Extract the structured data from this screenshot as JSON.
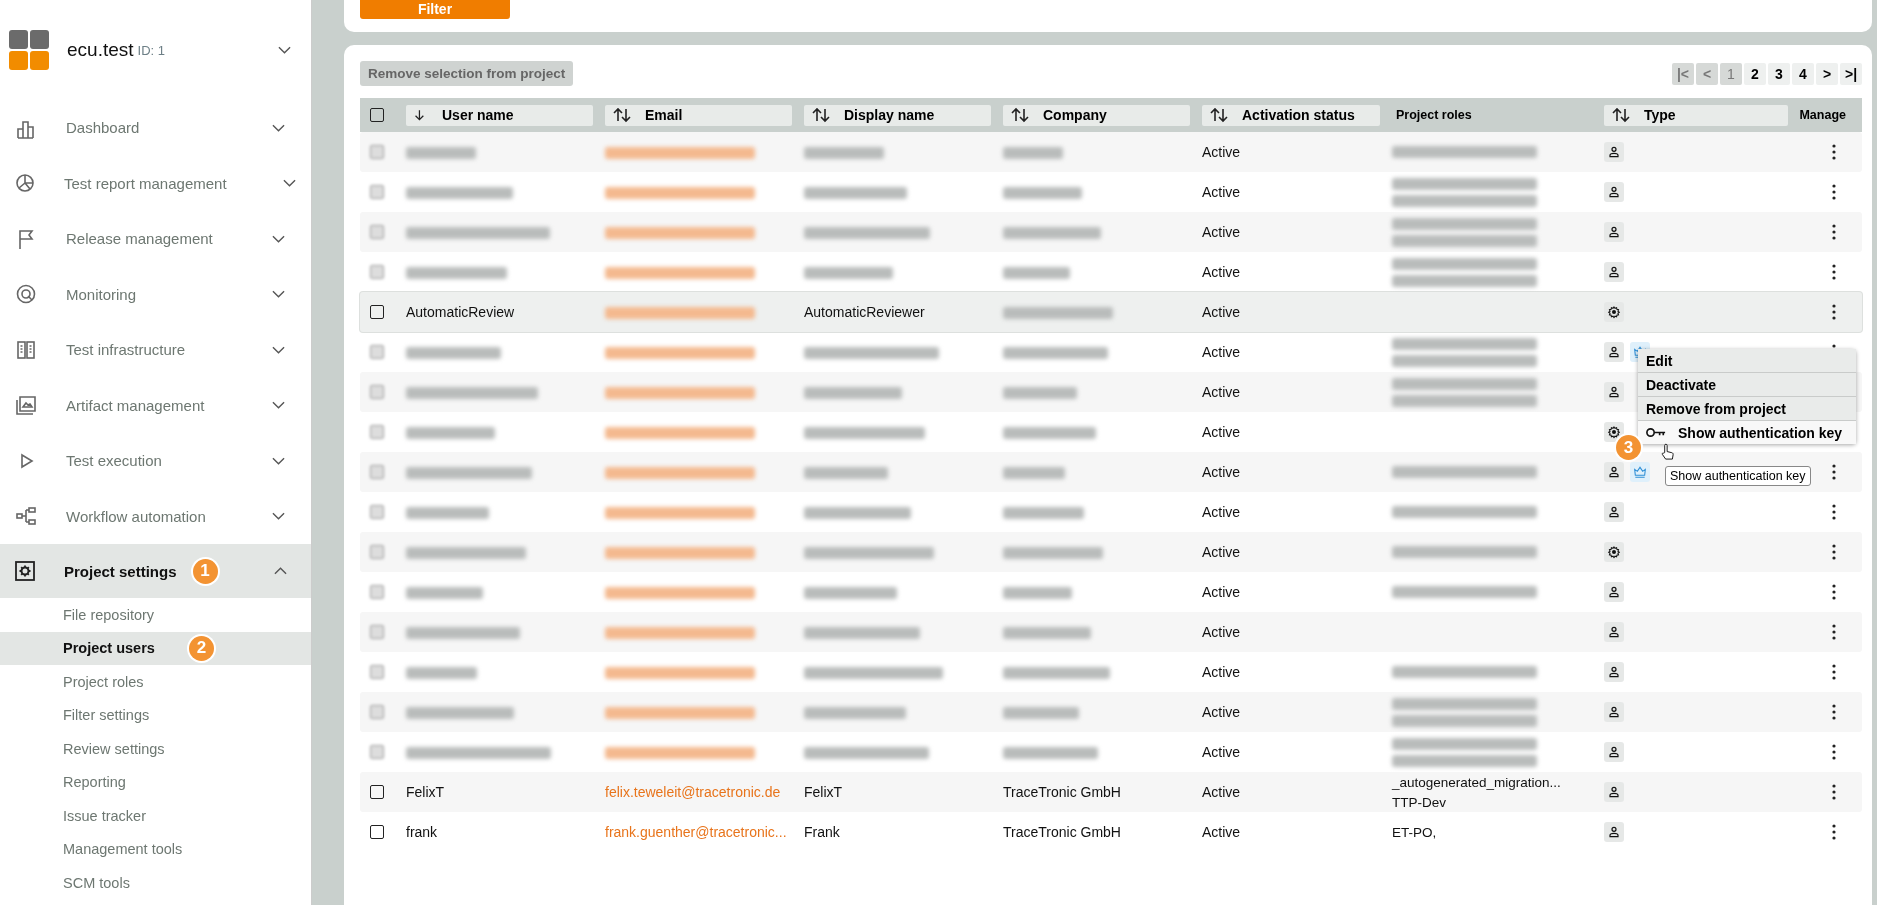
{
  "sidebar": {
    "product": "ecu.test",
    "product_id": "ID: 1",
    "items": [
      {
        "label": "Dashboard",
        "expanded": false,
        "selected": false
      },
      {
        "label": "Test report management",
        "expanded": false,
        "selected": false
      },
      {
        "label": "Release management",
        "expanded": false,
        "selected": false
      },
      {
        "label": "Monitoring",
        "expanded": false,
        "selected": false
      },
      {
        "label": "Test infrastructure",
        "expanded": false,
        "selected": false
      },
      {
        "label": "Artifact management",
        "expanded": false,
        "selected": false
      },
      {
        "label": "Test execution",
        "expanded": false,
        "selected": false
      },
      {
        "label": "Workflow automation",
        "expanded": false,
        "selected": false
      },
      {
        "label": "Project settings",
        "expanded": true,
        "selected": true,
        "marker": "1",
        "children": [
          {
            "label": "File repository",
            "selected": false
          },
          {
            "label": "Project users",
            "selected": true,
            "marker": "2"
          },
          {
            "label": "Project roles",
            "selected": false
          },
          {
            "label": "Filter settings",
            "selected": false
          },
          {
            "label": "Review settings",
            "selected": false
          },
          {
            "label": "Reporting",
            "selected": false
          },
          {
            "label": "Issue tracker",
            "selected": false
          },
          {
            "label": "Management tools",
            "selected": false
          },
          {
            "label": "SCM tools",
            "selected": false
          }
        ]
      }
    ]
  },
  "filter_button": "Filter",
  "remove_button": {
    "label": "Remove selection from project",
    "disabled": true
  },
  "pagination": {
    "first": {
      "label": "|<",
      "disabled": true
    },
    "prev": {
      "label": "<",
      "disabled": true
    },
    "pages": [
      {
        "label": "1",
        "selected": true
      },
      {
        "label": "2",
        "selected": false
      },
      {
        "label": "3",
        "selected": false
      },
      {
        "label": "4",
        "selected": false
      }
    ],
    "next": {
      "label": ">",
      "disabled": false
    },
    "last": {
      "label": ">|",
      "disabled": false
    }
  },
  "table": {
    "select_all_checked": false,
    "columns": [
      {
        "label": "User name",
        "kind": "sorted"
      },
      {
        "label": "Email",
        "kind": "sortable"
      },
      {
        "label": "Display name",
        "kind": "sortable"
      },
      {
        "label": "Company",
        "kind": "sortable"
      },
      {
        "label": "Activation status",
        "kind": "sortable"
      },
      {
        "label": "Project roles",
        "kind": "plain"
      },
      {
        "label": "Type",
        "kind": "sortable"
      },
      {
        "label": "Manage",
        "kind": "plain"
      }
    ],
    "rows": [
      {
        "checked": false,
        "blurred": true,
        "highlighted": false,
        "status": "Active",
        "roles": [
          {
            "blurred": true
          }
        ],
        "kind": "user",
        "admin": false
      },
      {
        "checked": false,
        "blurred": true,
        "highlighted": false,
        "status": "Active",
        "roles": [
          {
            "blurred": true
          },
          {
            "blurred": true
          }
        ],
        "kind": "user",
        "admin": false
      },
      {
        "checked": false,
        "blurred": true,
        "highlighted": false,
        "status": "Active",
        "roles": [
          {
            "blurred": true
          },
          {
            "blurred": true
          }
        ],
        "kind": "user",
        "admin": false
      },
      {
        "checked": false,
        "blurred": true,
        "highlighted": false,
        "status": "Active",
        "roles": [
          {
            "blurred": true
          },
          {
            "blurred": true
          }
        ],
        "kind": "user",
        "admin": false
      },
      {
        "checked": false,
        "blurred": false,
        "highlighted": true,
        "user_name": "AutomaticReview",
        "email": {
          "blurred": true
        },
        "display_name": "AutomaticReviewer",
        "company": {
          "blurred": true
        },
        "status": "Active",
        "roles": [],
        "kind": "technical",
        "admin": false
      },
      {
        "checked": false,
        "blurred": true,
        "highlighted": false,
        "status": "Active",
        "roles": [
          {
            "blurred": true
          },
          {
            "blurred": true
          }
        ],
        "kind": "user",
        "admin": true
      },
      {
        "checked": false,
        "blurred": true,
        "highlighted": false,
        "status": "Active",
        "roles": [
          {
            "blurred": true
          },
          {
            "blurred": true
          }
        ],
        "kind": "user",
        "admin": false
      },
      {
        "checked": false,
        "blurred": true,
        "highlighted": false,
        "status": "Active",
        "roles": [],
        "kind": "technical",
        "admin": false
      },
      {
        "checked": false,
        "blurred": true,
        "highlighted": false,
        "status": "Active",
        "roles": [
          {
            "blurred": true
          }
        ],
        "kind": "user",
        "admin": true
      },
      {
        "checked": false,
        "blurred": true,
        "highlighted": false,
        "status": "Active",
        "roles": [
          {
            "blurred": true
          }
        ],
        "kind": "user",
        "admin": false
      },
      {
        "checked": false,
        "blurred": true,
        "highlighted": false,
        "status": "Active",
        "roles": [
          {
            "blurred": true
          }
        ],
        "kind": "technical",
        "admin": false
      },
      {
        "checked": false,
        "blurred": true,
        "highlighted": false,
        "status": "Active",
        "roles": [
          {
            "blurred": true
          }
        ],
        "kind": "user",
        "admin": false
      },
      {
        "checked": false,
        "blurred": true,
        "highlighted": false,
        "status": "Active",
        "roles": [],
        "kind": "user",
        "admin": false
      },
      {
        "checked": false,
        "blurred": true,
        "highlighted": false,
        "status": "Active",
        "roles": [
          {
            "blurred": true
          }
        ],
        "kind": "user",
        "admin": false
      },
      {
        "checked": false,
        "blurred": true,
        "highlighted": false,
        "status": "Active",
        "roles": [
          {
            "blurred": true
          },
          {
            "blurred": true
          }
        ],
        "kind": "user",
        "admin": false
      },
      {
        "checked": false,
        "blurred": true,
        "highlighted": false,
        "status": "Active",
        "roles": [
          {
            "blurred": true
          },
          {
            "blurred": true
          }
        ],
        "kind": "user",
        "admin": false
      },
      {
        "checked": false,
        "blurred": false,
        "highlighted": false,
        "user_name": "FelixT",
        "email": "felix.teweleit@tracetronic.de",
        "display_name": "FelixT",
        "company": "TraceTronic GmbH",
        "status": "Active",
        "roles": [
          "_autogenerated_migration...",
          "TTP-Dev"
        ],
        "kind": "user",
        "admin": false
      },
      {
        "checked": false,
        "blurred": false,
        "highlighted": false,
        "user_name": "frank",
        "email": "frank.guenther@tracetronic...",
        "display_name": "Frank",
        "company": "TraceTronic GmbH",
        "status": "Active",
        "roles": [
          "ET-PO,"
        ],
        "kind": "user",
        "admin": false
      }
    ]
  },
  "context_menu": {
    "items": [
      {
        "label": "Edit",
        "kind": "plain",
        "hovered": false
      },
      {
        "label": "Deactivate",
        "kind": "plain",
        "hovered": false
      },
      {
        "label": "Remove from project",
        "kind": "plain",
        "hovered": false
      },
      {
        "label": "Show authentication key",
        "kind": "key",
        "hovered": true,
        "marker": "3"
      }
    ],
    "tooltip": "Show authentication key"
  }
}
